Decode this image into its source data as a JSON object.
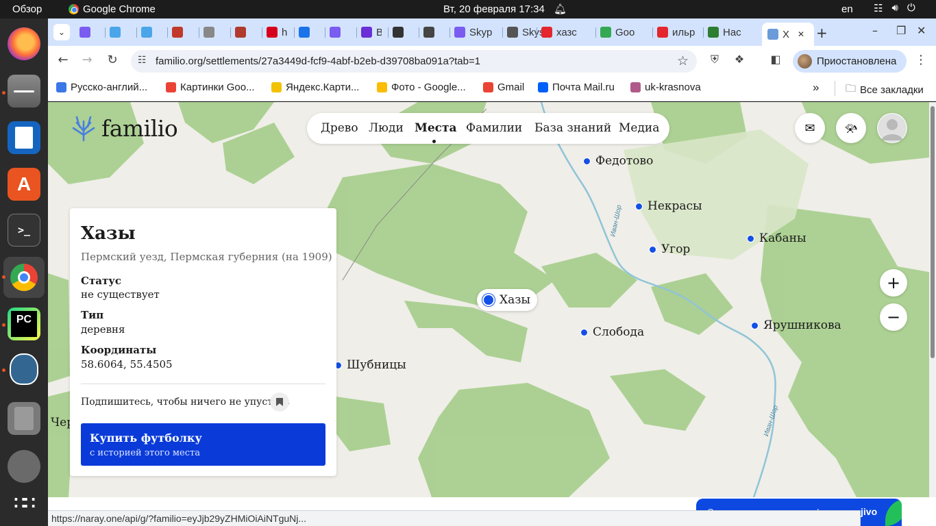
{
  "os": {
    "overview": "Обзор",
    "active_app": "Google Chrome",
    "clock": "Вт, 20 февраля  17:34",
    "lang": "en"
  },
  "tabs": [
    {
      "label": "",
      "color": "#7b5cf0"
    },
    {
      "label": "",
      "color": "#4aa6e8"
    },
    {
      "label": "",
      "color": "#4aa6e8"
    },
    {
      "label": "",
      "color": "#c0392b"
    },
    {
      "label": "",
      "color": "#888888"
    },
    {
      "label": "",
      "color": "#b03a2e"
    },
    {
      "label": "hh",
      "color": "#d6001c"
    },
    {
      "label": "",
      "color": "#1a73e8"
    },
    {
      "label": "",
      "color": "#7b5cf0"
    },
    {
      "label": "B",
      "color": "#6a2fd6"
    },
    {
      "label": "",
      "color": "#333333"
    },
    {
      "label": "",
      "color": "#444444"
    },
    {
      "label": "Skyp",
      "color": "#7b5cf0"
    },
    {
      "label": "Skys",
      "color": "#555555"
    },
    {
      "label": "хазс",
      "color": "#e4262d"
    },
    {
      "label": "Goo",
      "color": "#34a853"
    },
    {
      "label": "ильр",
      "color": "#e4262d"
    },
    {
      "label": "Нас",
      "color": "#2e7d32"
    },
    {
      "label": "Х",
      "color": "#6b9bd9"
    }
  ],
  "url": "familio.org/settlements/27a3449d-fcf9-4abf-b2eb-d39708ba091a?tab=1",
  "profile": "Приостановлена",
  "bookmarks": [
    {
      "label": "Русско-англий...",
      "color": "#3b78e7"
    },
    {
      "label": "Картинки Goo...",
      "color": "#ea4335"
    },
    {
      "label": "Яндекс.Карти...",
      "color": "#f2c200"
    },
    {
      "label": "Фото - Google...",
      "color": "#fbbc04"
    },
    {
      "label": "Gmail",
      "color": "#ea4335"
    },
    {
      "label": "Почта Mail.ru",
      "color": "#005ff9"
    },
    {
      "label": "uk-krasnova",
      "color": "#b05a8a"
    }
  ],
  "all_bookmarks": "Все закладки",
  "site": {
    "logo": "familio",
    "nav": [
      "Древо",
      "Люди",
      "Места",
      "Фамилии",
      "База знаний",
      "Медиа"
    ],
    "nav_active": "Места"
  },
  "places": {
    "fedotovo": "Федотово",
    "nekrasy": "Некрасы",
    "ugor": "Угор",
    "kabany": "Кабаны",
    "khazy": "Хазы",
    "sloboda": "Слобода",
    "yarushnikova": "Ярушникова",
    "shubnitsy": "Шубницы",
    "cher": "Чер"
  },
  "river": "Иван-Шор",
  "settlement": {
    "name": "Хазы",
    "region": "Пермский уезд, Пермская губерния (на 1909)",
    "status_label": "Статус",
    "status": "не существует",
    "type_label": "Тип",
    "type": "деревня",
    "coords_label": "Координаты",
    "coords": "58.6064, 55.4505",
    "subscribe": "Подпишитесь, чтобы ничего не упустить",
    "buy_title": "Купить футболку",
    "buy_sub": "с историей этого места"
  },
  "status_url": "https://naray.one/api/g/?familio=eyJjb29yZHMiOiAiNTguNj...",
  "chat": {
    "text": "Ответим на ваши вопросы!",
    "brand": "jivo"
  }
}
